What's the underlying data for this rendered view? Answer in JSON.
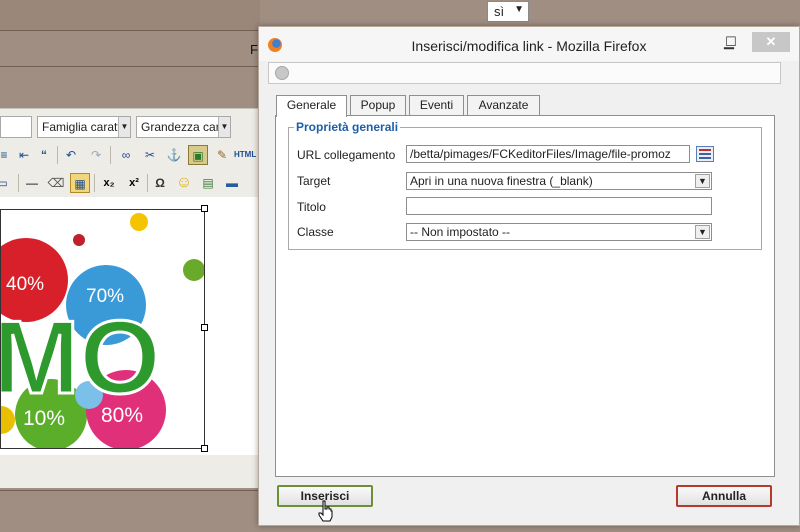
{
  "background": {
    "select_value": "sì",
    "clipped_letter": "F",
    "toolbar": {
      "font_family_label": "Famiglia caratt",
      "font_size_label": "Grandezza car",
      "html_button": "HTML"
    },
    "image_texts": [
      "40%",
      "70%",
      "10%",
      "80%",
      "MO"
    ]
  },
  "dialog": {
    "title": "Inserisci/modifica link - Mozilla Firefox",
    "window_controls": [
      "minimize",
      "maximize",
      "close"
    ],
    "tabs": [
      {
        "label": "Generale",
        "active": true
      },
      {
        "label": "Popup",
        "active": false
      },
      {
        "label": "Eventi",
        "active": false
      },
      {
        "label": "Avanzate",
        "active": false
      }
    ],
    "section_title": "Proprietà generali",
    "fields": {
      "url": {
        "label": "URL collegamento",
        "value": "/betta/pimages/FCKeditorFiles/Image/file-promoz"
      },
      "target": {
        "label": "Target",
        "value": "Apri in una nuova finestra (_blank)"
      },
      "title": {
        "label": "Titolo",
        "value": ""
      },
      "class": {
        "label": "Classe",
        "value": "-- Non impostato --"
      }
    },
    "buttons": {
      "insert": "Inserisci",
      "cancel": "Annulla"
    }
  },
  "colors": {
    "legend": "#1f5fa8",
    "insert_border": "#6e8f3a",
    "cancel_border": "#b63a2c"
  }
}
